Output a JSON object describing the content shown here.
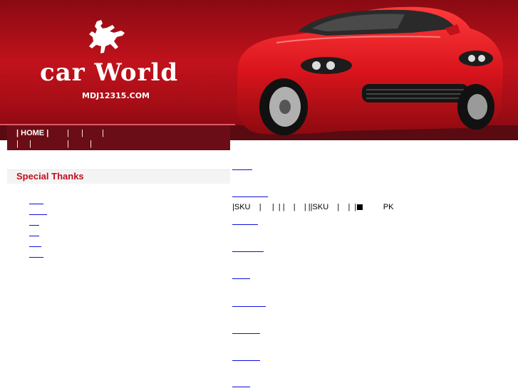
{
  "header": {
    "brand": "car World",
    "domain": "MDJ12315.COM"
  },
  "nav": {
    "row1": {
      "home": "| HOME |",
      "sep1": "|",
      "sep2": "|",
      "sep3": "|"
    },
    "row2": {
      "sep1": "|",
      "sep2": "|",
      "sep3": "|",
      "sep4": "|"
    }
  },
  "sidebar": {
    "heading": "Special Thanks",
    "links": [
      "",
      "",
      "",
      "",
      "",
      ""
    ]
  },
  "main": {
    "info_line": {
      "part1": "|SKU    |     |  | |    |    | ||SKU    |    |  |",
      "part2": "         PK"
    },
    "links": [
      "",
      "",
      "",
      "",
      "",
      "",
      "",
      "",
      "",
      ""
    ]
  },
  "colors": {
    "header_red": "#c1121c",
    "nav_bg": "#6b0d16",
    "heading_red": "#c0101c",
    "link_blue": "#1010dd"
  },
  "icons": {
    "logo": "bronco-rider-icon",
    "hero": "red-sports-car-image"
  }
}
